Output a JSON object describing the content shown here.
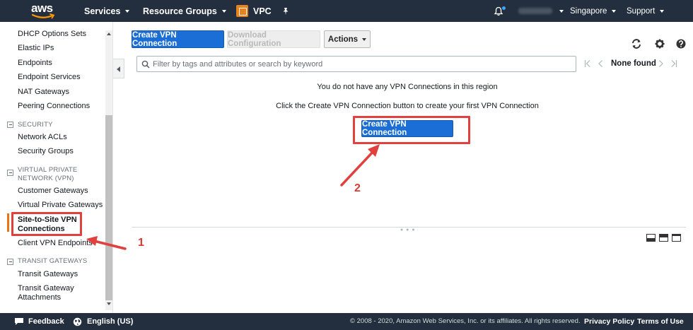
{
  "topnav": {
    "logo_text": "aws",
    "services": "Services",
    "resource_groups": "Resource Groups",
    "service_name": "VPC",
    "region": "Singapore",
    "support": "Support"
  },
  "sidebar": {
    "items_top": [
      "DHCP Options Sets",
      "Elastic IPs",
      "Endpoints",
      "Endpoint Services",
      "NAT Gateways",
      "Peering Connections"
    ],
    "security": {
      "title": "SECURITY",
      "items": [
        "Network ACLs",
        "Security Groups"
      ]
    },
    "vpn": {
      "title_line1": "VIRTUAL PRIVATE",
      "title_line2": "NETWORK (VPN)",
      "items": [
        "Customer Gateways",
        "Virtual Private Gateways",
        "Client VPN Endpoints"
      ],
      "active_line1": "Site-to-Site VPN",
      "active_line2": "Connections"
    },
    "transit": {
      "title": "TRANSIT GATEWAYS",
      "items": [
        "Transit Gateways"
      ],
      "attachments_line1": "Transit Gateway",
      "attachments_line2": "Attachments"
    }
  },
  "toolbar": {
    "create_label": "Create VPN Connection",
    "download_label": "Download Configuration",
    "actions_label": "Actions"
  },
  "filter": {
    "placeholder": "Filter by tags and attributes or search by keyword",
    "pager_label": "None found"
  },
  "empty_state": {
    "line1": "You do not have any VPN Connections in this region",
    "line2": "Click the Create VPN Connection button to create your first VPN Connection",
    "button_label": "Create VPN Connection"
  },
  "annotations": {
    "callout_1": "1",
    "callout_2": "2",
    "color": "#e0403e"
  },
  "footer": {
    "feedback": "Feedback",
    "language": "English (US)",
    "copyright": "© 2008 - 2020, Amazon Web Services, Inc. or its affiliates. All rights reserved.",
    "privacy": "Privacy Policy",
    "terms": "Terms of Use"
  },
  "colors": {
    "nav_bg": "#232f3e",
    "primary": "#1b6ed6",
    "active_accent": "#ec7211"
  }
}
